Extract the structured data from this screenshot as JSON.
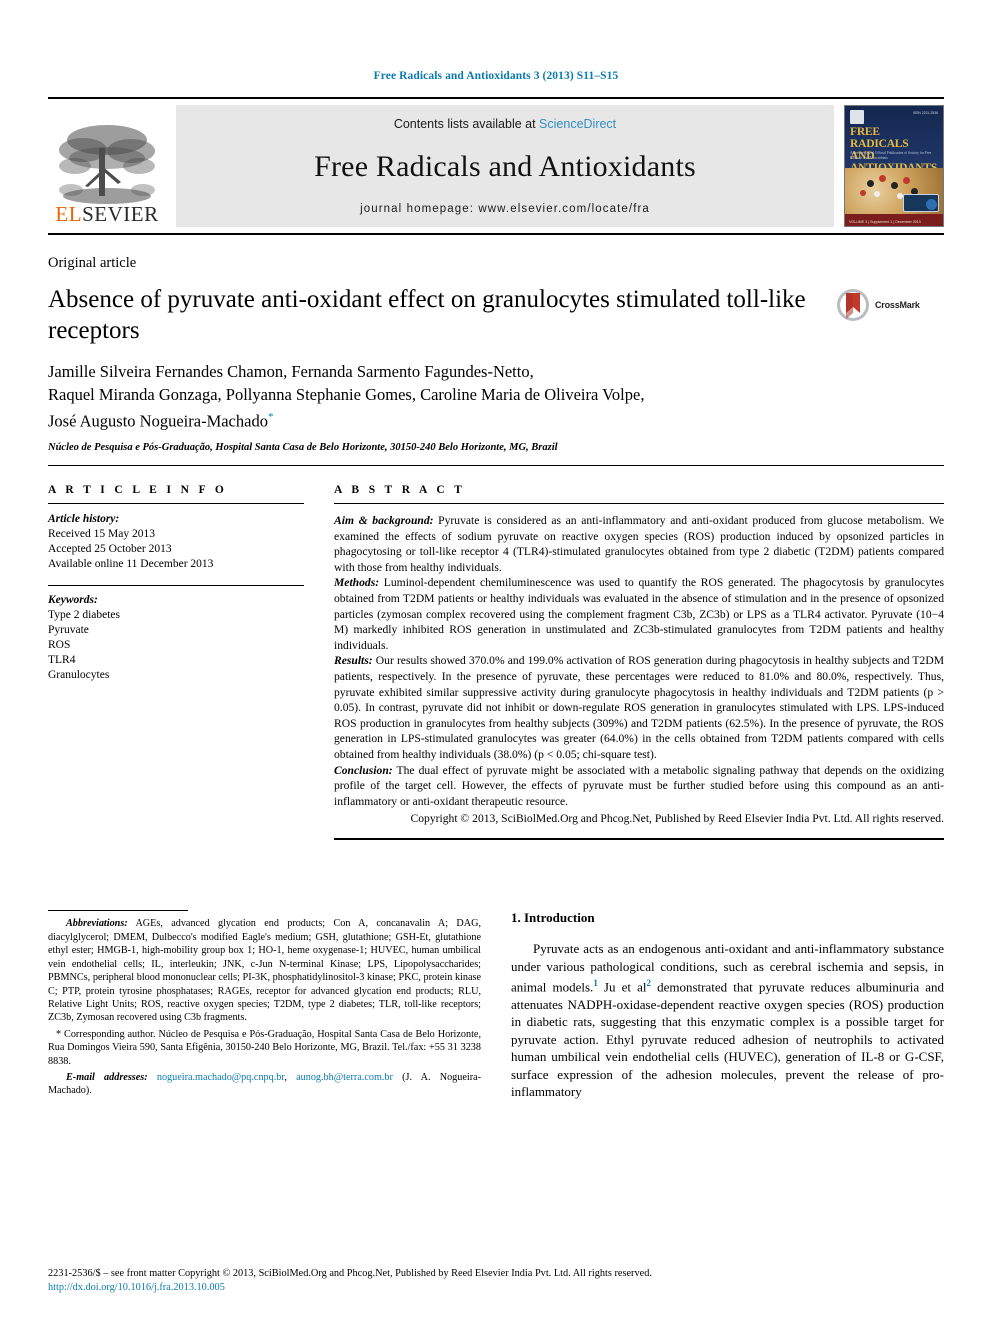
{
  "running_head": "Free Radicals and Antioxidants 3 (2013) S11–S15",
  "banner": {
    "publisher": "ELSEVIER",
    "contents_prefix": "Contents lists available at ",
    "contents_link": "ScienceDirect",
    "journal_name": "Free Radicals and Antioxidants",
    "homepage": "journal homepage: www.elsevier.com/locate/fra",
    "cover": {
      "title_line1": "FREE RADICALS",
      "title_line2": "AND ANTIOXIDANTS",
      "subtitle": "A Peer-reviewed Official Publication of Society for Free Radicals and Antioxidants",
      "issn": "ISSN 2231-2536",
      "bottom_bar": "VOLUME 3 | Supplement 1 | December 2013"
    }
  },
  "article": {
    "type": "Original article",
    "title": "Absence of pyruvate anti-oxidant effect on granulocytes stimulated toll-like receptors",
    "crossmark_label": "CrossMark",
    "authors_line1": "Jamille Silveira Fernandes Chamon, Fernanda Sarmento Fagundes-Netto,",
    "authors_line2": "Raquel Miranda Gonzaga, Pollyanna Stephanie Gomes, Caroline Maria de Oliveira Volpe,",
    "authors_line3": "José Augusto Nogueira-Machado",
    "corresponding_marker": "*",
    "affiliation": "Núcleo de Pesquisa e Pós-Graduação, Hospital Santa Casa de Belo Horizonte, 30150-240 Belo Horizonte, MG, Brazil"
  },
  "article_info": {
    "heading": "A R T I C L E  I N F O",
    "history_label": "Article history:",
    "history": [
      "Received 15 May 2013",
      "Accepted 25 October 2013",
      "Available online 11 December 2013"
    ],
    "keywords_label": "Keywords:",
    "keywords": [
      "Type 2 diabetes",
      "Pyruvate",
      "ROS",
      "TLR4",
      "Granulocytes"
    ]
  },
  "abstract": {
    "heading": "A B S T R A C T",
    "aim_label": "Aim & background:",
    "aim_text": " Pyruvate is considered as an anti-inflammatory and anti-oxidant produced from glucose metabolism. We examined the effects of sodium pyruvate on reactive oxygen species (ROS) production induced by opsonized particles in phagocytosing or toll-like receptor 4 (TLR4)-stimulated granulocytes obtained from type 2 diabetic (T2DM) patients compared with those from healthy individuals.",
    "methods_label": "Methods:",
    "methods_text": " Luminol-dependent chemiluminescence was used to quantify the ROS generated. The phagocytosis by granulocytes obtained from T2DM patients or healthy individuals was evaluated in the absence of stimulation and in the presence of opsonized particles (zymosan complex recovered using the complement fragment C3b, ZC3b) or LPS as a TLR4 activator. Pyruvate (10−4 M) markedly inhibited ROS generation in unstimulated and ZC3b-stimulated granulocytes from T2DM patients and healthy individuals.",
    "results_label": "Results:",
    "results_text": " Our results showed 370.0% and 199.0% activation of ROS generation during phagocytosis in healthy subjects and T2DM patients, respectively. In the presence of pyruvate, these percentages were reduced to 81.0% and 80.0%, respectively. Thus, pyruvate exhibited similar suppressive activity during granulocyte phagocytosis in healthy individuals and T2DM patients (p > 0.05). In contrast, pyruvate did not inhibit or down-regulate ROS generation in granulocytes stimulated with LPS. LPS-induced ROS production in granulocytes from healthy subjects (309%) and T2DM patients (62.5%). In the presence of pyruvate, the ROS generation in LPS-stimulated granulocytes was greater (64.0%) in the cells obtained from T2DM patients compared with cells obtained from healthy individuals (38.0%) (p < 0.05; chi-square test).",
    "conclusion_label": "Conclusion:",
    "conclusion_text": " The dual effect of pyruvate might be associated with a metabolic signaling pathway that depends on the oxidizing profile of the target cell. However, the effects of pyruvate must be further studied before using this compound as an anti-inflammatory or anti-oxidant therapeutic resource.",
    "copyright": "Copyright © 2013, SciBiolMed.Org and Phcog.Net, Published by Reed Elsevier India Pvt. Ltd. All rights reserved."
  },
  "footnotes": {
    "abbreviations_label": "Abbreviations:",
    "abbreviations_text": " AGEs, advanced glycation end products; Con A, concanavalin A; DAG, diacylglycerol; DMEM, Dulbecco's modified Eagle's medium; GSH, glutathione; GSH-Et, glutathione ethyl ester; HMGB-1, high-mobility group box 1; HO-1, heme oxygenase-1; HUVEC, human umbilical vein endothelial cells; IL, interleukin; JNK, c-Jun N-terminal Kinase; LPS, Lipopolysaccharides; PBMNCs, peripheral blood mononuclear cells; PI-3K, phosphatidylinositol-3 kinase; PKC, protein kinase C; PTP, protein tyrosine phosphatases; RAGEs, receptor for advanced glycation end products; RLU, Relative Light Units; ROS, reactive oxygen species; T2DM, type 2 diabetes; TLR, toll-like receptors; ZC3b, Zymosan recovered using C3b fragments.",
    "corresponding_text": "* Corresponding author. Núcleo de Pesquisa e Pós-Graduação, Hospital Santa Casa de Belo Horizonte, Rua Domingos Vieira 590, Santa Efigênia, 30150-240 Belo Horizonte, MG, Brazil. Tel./fax: +55 31 3238 8838.",
    "email_label": "E-mail addresses:",
    "email_1": "nogueira.machado@pq.cnpq.br",
    "email_sep": ", ",
    "email_2": "aunog.bh@terra.com.br",
    "email_suffix": " (J. A. Nogueira-Machado)."
  },
  "introduction": {
    "heading": "1.  Introduction",
    "para_part1": "Pyruvate acts as an endogenous anti-oxidant and anti-inflammatory substance under various pathological conditions, such as cerebral ischemia and sepsis, in animal models.",
    "ref1": "1",
    "para_part2": " Ju et al",
    "ref2": "2",
    "para_part3": " demonstrated that pyruvate reduces albuminuria and attenuates NADPH-oxidase-dependent reactive oxygen species (ROS) production in diabetic rats, suggesting that this enzymatic complex is a possible target for pyruvate action. Ethyl pyruvate reduced adhesion of neutrophils to activated human umbilical vein endothelial cells (HUVEC), generation of IL-8 or G-CSF, surface expression of the adhesion molecules, prevent the release of pro-inflammatory"
  },
  "page_footer": {
    "line1": "2231-2536/$ – see front matter Copyright © 2013, SciBiolMed.Org and Phcog.Net, Published by Reed Elsevier India Pvt. Ltd. All rights reserved.",
    "doi": "http://dx.doi.org/10.1016/j.fra.2013.10.005"
  },
  "colors": {
    "link": "#0b7ab0",
    "sciencedirect": "#2f8fc4",
    "elsevier_orange": "#ec6608",
    "banner_bg": "#e7e7e7"
  }
}
